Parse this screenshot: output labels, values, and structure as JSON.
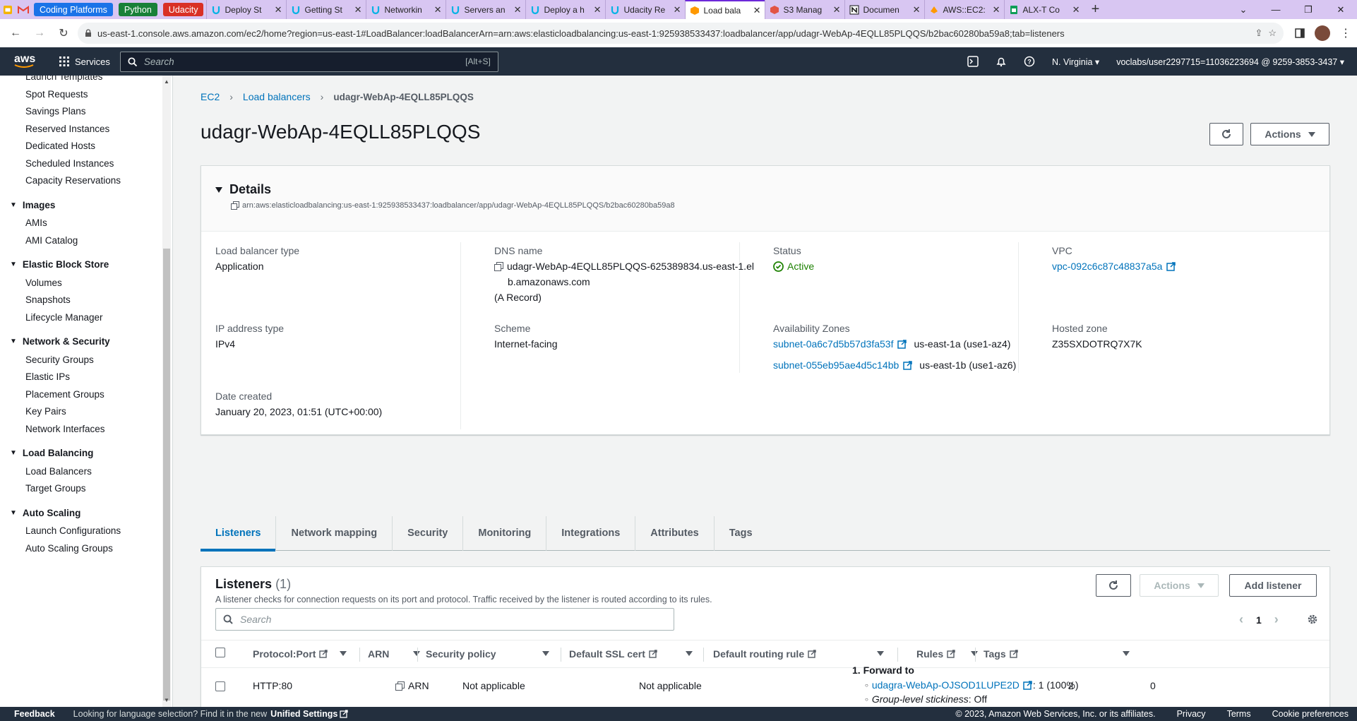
{
  "browser": {
    "pills": [
      {
        "label": "Coding Platforms",
        "color": "#1a73e8"
      },
      {
        "label": "Python",
        "color": "#188038"
      },
      {
        "label": "Udacity",
        "color": "#d93025"
      }
    ],
    "tabs": [
      {
        "label": "Deploy St",
        "icon": "udacity"
      },
      {
        "label": "Getting St",
        "icon": "udacity"
      },
      {
        "label": "Networkin",
        "icon": "udacity"
      },
      {
        "label": "Servers an",
        "icon": "udacity"
      },
      {
        "label": "Deploy a h",
        "icon": "udacity"
      },
      {
        "label": "Udacity Re",
        "icon": "udacity"
      },
      {
        "label": "Load bala",
        "icon": "aws-ec2",
        "active": true
      },
      {
        "label": "S3 Manag",
        "icon": "aws-s3"
      },
      {
        "label": "Documen",
        "icon": "notion"
      },
      {
        "label": "AWS::EC2:",
        "icon": "aws-cfn"
      },
      {
        "label": "ALX-T Co",
        "icon": "sheets"
      }
    ],
    "url": "us-east-1.console.aws.amazon.com/ec2/home?region=us-east-1#LoadBalancer:loadBalancerArn=arn:aws:elasticloadbalancing:us-east-1:925938533437:loadbalancer/app/udagr-WebAp-4EQLL85PLQQS/b2bac60280ba59a8;tab=listeners"
  },
  "aws_header": {
    "logo": "aws",
    "services": "Services",
    "search_placeholder": "Search",
    "search_shortcut": "[Alt+S]",
    "region": "N. Virginia",
    "account": "voclabs/user2297715=11036223694 @ 9259-3853-3437"
  },
  "sidebar": {
    "items_top": [
      "Launch Templates",
      "Spot Requests",
      "Savings Plans",
      "Reserved Instances",
      "Dedicated Hosts",
      "Scheduled Instances",
      "Capacity Reservations"
    ],
    "sections": [
      {
        "title": "Images",
        "items": [
          "AMIs",
          "AMI Catalog"
        ]
      },
      {
        "title": "Elastic Block Store",
        "items": [
          "Volumes",
          "Snapshots",
          "Lifecycle Manager"
        ]
      },
      {
        "title": "Network & Security",
        "items": [
          "Security Groups",
          "Elastic IPs",
          "Placement Groups",
          "Key Pairs",
          "Network Interfaces"
        ]
      },
      {
        "title": "Load Balancing",
        "items": [
          "Load Balancers",
          "Target Groups"
        ]
      },
      {
        "title": "Auto Scaling",
        "items": [
          "Launch Configurations",
          "Auto Scaling Groups"
        ]
      }
    ]
  },
  "breadcrumb": {
    "ec2": "EC2",
    "lbs": "Load balancers",
    "current": "udagr-WebAp-4EQLL85PLQQS"
  },
  "page": {
    "title": "udagr-WebAp-4EQLL85PLQQS",
    "actions": "Actions"
  },
  "details": {
    "title": "Details",
    "arn": "arn:aws:elasticloadbalancing:us-east-1:925938533437:loadbalancer/app/udagr-WebAp-4EQLL85PLQQS/b2bac60280ba59a8",
    "lb_type_label": "Load balancer type",
    "lb_type": "Application",
    "dns_label": "DNS name",
    "dns_line1": "udagr-WebAp-4EQLL85PLQQS-625389834.us-east-1.el",
    "dns_line2": "b.amazonaws.com",
    "dns_record": "(A Record)",
    "status_label": "Status",
    "status": "Active",
    "vpc_label": "VPC",
    "vpc": "vpc-092c6c87c48837a5a",
    "ip_label": "IP address type",
    "ip": "IPv4",
    "scheme_label": "Scheme",
    "scheme": "Internet-facing",
    "az_label": "Availability Zones",
    "az1_subnet": "subnet-0a6c7d5b57d3fa53f",
    "az1_zone": "us-east-1a (use1-az4)",
    "az2_subnet": "subnet-055eb95ae4d5c14bb",
    "az2_zone": "us-east-1b (use1-az6)",
    "hz_label": "Hosted zone",
    "hz": "Z35SXDOTRQ7X7K",
    "date_label": "Date created",
    "date": "January 20, 2023, 01:51 (UTC+00:00)"
  },
  "tabs": [
    "Listeners",
    "Network mapping",
    "Security",
    "Monitoring",
    "Integrations",
    "Attributes",
    "Tags"
  ],
  "listeners": {
    "title": "Listeners",
    "count": "(1)",
    "description": "A listener checks for connection requests on its port and protocol. Traffic received by the listener is routed according to its rules.",
    "actions": "Actions",
    "add": "Add listener",
    "search_placeholder": "Search",
    "page": "1",
    "columns": [
      "Protocol:Port",
      "ARN",
      "Security policy",
      "Default SSL cert",
      "Default routing rule",
      "Rules",
      "Tags"
    ],
    "row": {
      "protocol": "HTTP:80",
      "arn": "ARN",
      "policy": "Not applicable",
      "cert": "Not applicable",
      "rule_head": "1. Forward to",
      "target_group": "udagra-WebAp-OJSOD1LUPE2D",
      "target_weight": ": 1 (100%)",
      "stickiness_label": "Group-level stickiness",
      "stickiness_value": ": Off",
      "rules": "2",
      "tags": "0"
    }
  },
  "footer": {
    "feedback": "Feedback",
    "lang_text": "Looking for language selection? Find it in the new",
    "unified": "Unified Settings",
    "copyright": "© 2023, Amazon Web Services, Inc. or its affiliates.",
    "privacy": "Privacy",
    "terms": "Terms",
    "cookies": "Cookie preferences"
  }
}
